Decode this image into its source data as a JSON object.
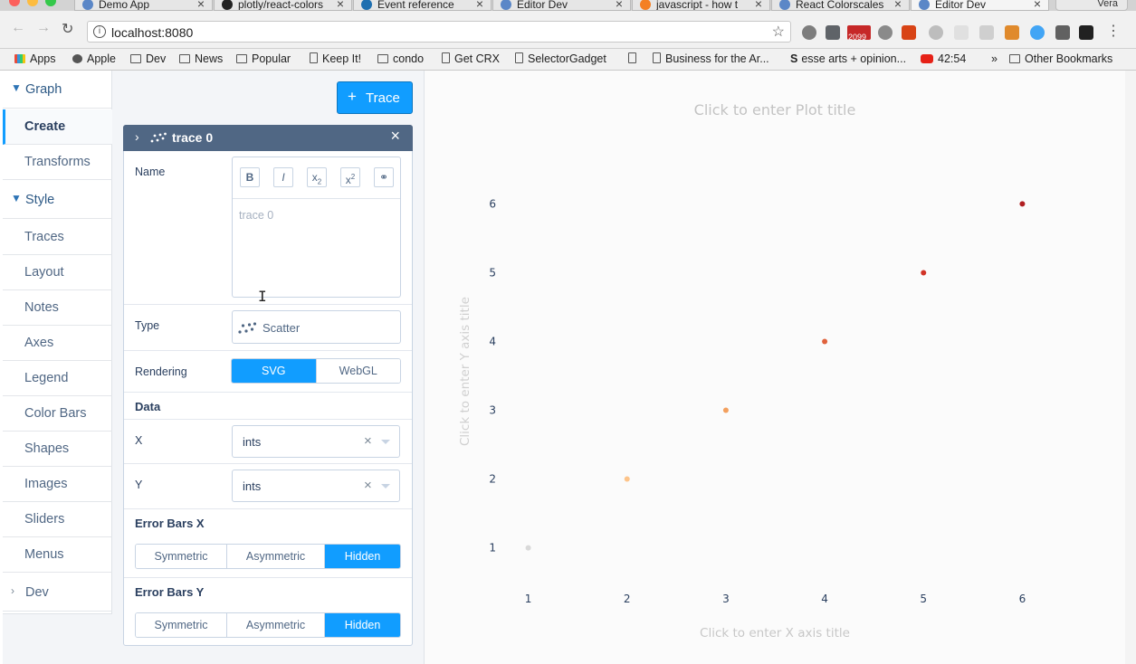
{
  "browser": {
    "tabs": [
      {
        "title": "Demo App",
        "active": false
      },
      {
        "title": "plotly/react-colors",
        "active": false
      },
      {
        "title": "Event reference",
        "active": false
      },
      {
        "title": "Editor Dev",
        "active": false
      },
      {
        "title": "javascript - how t",
        "active": false
      },
      {
        "title": "React Colorscales",
        "active": false
      },
      {
        "title": "Editor Dev",
        "active": true
      }
    ],
    "profile": "Vera",
    "url": "localhost:8080",
    "bookmarks": [
      "Apps",
      "Apple",
      "Dev",
      "News",
      "Popular",
      "Keep It!",
      "condo",
      "Get CRX",
      "SelectorGadget",
      "",
      "Business for the Ar...",
      "esse arts + opinion...",
      "42:54",
      "»",
      "Other Bookmarks"
    ],
    "extension_badge": "2099"
  },
  "sidebar": {
    "groups": [
      {
        "label": "Graph",
        "items": [
          "Create",
          "Transforms"
        ]
      },
      {
        "label": "Style",
        "items": [
          "Traces",
          "Layout",
          "Notes",
          "Axes",
          "Legend",
          "Color Bars",
          "Shapes",
          "Images",
          "Sliders",
          "Menus"
        ]
      },
      {
        "label": "Dev",
        "items": []
      }
    ],
    "selected": "Create"
  },
  "panel": {
    "add_trace_label": "Trace",
    "trace": {
      "title": "trace 0",
      "name_label": "Name",
      "rte_buttons": [
        "B",
        "I",
        "x2",
        "x2",
        "link"
      ],
      "name_placeholder": "trace 0",
      "type_label": "Type",
      "type_value": "Scatter",
      "rendering_label": "Rendering",
      "rendering_options": [
        "SVG",
        "WebGL"
      ],
      "rendering_selected": "SVG",
      "data_section": "Data",
      "x_label": "X",
      "x_value": "ints",
      "y_label": "Y",
      "y_value": "ints",
      "error_x_section": "Error Bars X",
      "error_y_section": "Error Bars Y",
      "error_options": [
        "Symmetric",
        "Asymmetric",
        "Hidden"
      ],
      "error_x_selected": "Hidden",
      "error_y_selected": "Hidden"
    }
  },
  "plot": {
    "title_placeholder": "Click to enter Plot title",
    "x_title_placeholder": "Click to enter X axis title",
    "y_title_placeholder": "Click to enter Y axis title"
  },
  "chart_data": {
    "type": "scatter",
    "x": [
      1,
      2,
      3,
      4,
      5,
      6
    ],
    "y": [
      1,
      2,
      3,
      4,
      5,
      6
    ],
    "marker_colors": [
      "#d9d9d9",
      "#fdc48a",
      "#f3a05e",
      "#e0623c",
      "#d13427",
      "#b01e21"
    ],
    "x_ticks": [
      1,
      2,
      3,
      4,
      5,
      6
    ],
    "y_ticks": [
      1,
      2,
      3,
      4,
      5,
      6
    ],
    "xlim": [
      0.5,
      6.5
    ],
    "ylim": [
      0.6,
      6.4
    ],
    "grid": false
  },
  "colors": {
    "accent": "#119dff",
    "header": "#506784",
    "text": "#2a3f5f"
  }
}
